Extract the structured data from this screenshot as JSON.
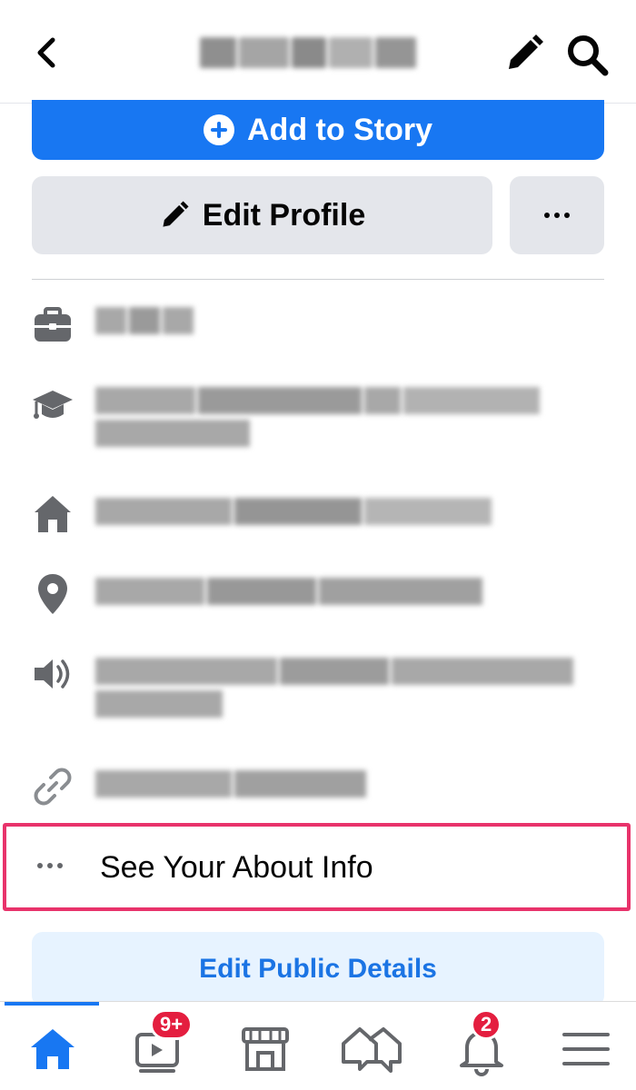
{
  "header": {
    "back_icon": "chevron-left-icon",
    "title": "",
    "edit_icon": "pencil-icon",
    "search_icon": "search-icon"
  },
  "profile_actions": {
    "add_story_label": "Add to Story",
    "edit_profile_label": "Edit Profile",
    "more_icon": "more-horizontal-icon"
  },
  "info_items": [
    {
      "icon": "briefcase-icon",
      "text": ""
    },
    {
      "icon": "graduation-cap-icon",
      "text": ""
    },
    {
      "icon": "home-icon",
      "text": ""
    },
    {
      "icon": "location-pin-icon",
      "text": ""
    },
    {
      "icon": "speaker-icon",
      "text": ""
    },
    {
      "icon": "link-icon",
      "text": ""
    }
  ],
  "about": {
    "label": "See Your About Info",
    "highlight_color": "#e8336b"
  },
  "edit_public_label": "Edit Public Details",
  "bottom_nav": {
    "items": [
      {
        "icon": "home-icon",
        "active": true
      },
      {
        "icon": "video-icon",
        "badge": "9+"
      },
      {
        "icon": "marketplace-icon"
      },
      {
        "icon": "groups-icon"
      },
      {
        "icon": "bell-icon",
        "badge": "2"
      },
      {
        "icon": "menu-icon"
      }
    ]
  },
  "colors": {
    "primary": "#1877f2",
    "secondary_button": "#e4e6eb",
    "light_blue_button": "#e7f3ff",
    "badge": "#e41e3f",
    "icon_gray": "#65676b"
  }
}
